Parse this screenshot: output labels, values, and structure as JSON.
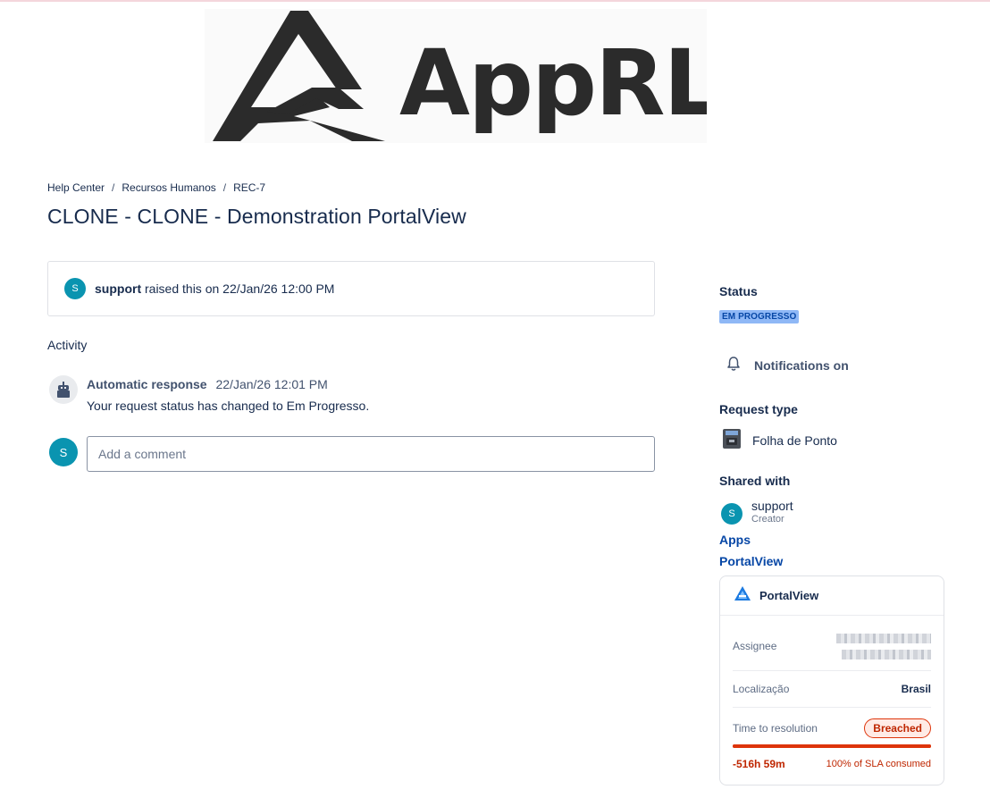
{
  "logo": {
    "text": "AppRL"
  },
  "breadcrumb": {
    "items": [
      "Help Center",
      "Recursos Humanos",
      "REC-7"
    ],
    "separator": "/"
  },
  "page_title": "CLONE - CLONE - Demonstration PortalView",
  "raised": {
    "avatar_initial": "S",
    "author": "support",
    "text": "raised this on 22/Jan/26 12:00 PM"
  },
  "activity": {
    "heading": "Activity",
    "items": [
      {
        "author": "Automatic response",
        "time": "22/Jan/26 12:01 PM",
        "message": "Your request status has changed to Em Progresso."
      }
    ]
  },
  "comment": {
    "avatar_initial": "S",
    "placeholder": "Add a comment"
  },
  "sidebar": {
    "status_label": "Status",
    "status_value": "EM PROGRESSO",
    "notifications": "Notifications on",
    "request_type_label": "Request type",
    "request_type_value": "Folha de Ponto",
    "shared_label": "Shared with",
    "shared_user": {
      "initial": "S",
      "name": "support",
      "role": "Creator"
    },
    "apps_label": "Apps",
    "apps_link": "PortalView"
  },
  "portalview_card": {
    "title": "PortalView",
    "assignee_label": "Assignee",
    "localizacao_label": "Localização",
    "localizacao_value": "Brasil",
    "resolution_label": "Time to resolution",
    "resolution_badge": "Breached",
    "sla_consumed_fraction": 1.0,
    "time_value": "-516h 59m",
    "sla_text": "100% of SLA consumed"
  },
  "colors": {
    "avatar": "#0a94b0",
    "status_lozenge": "#8fb8f6",
    "breached": "#de350b",
    "link": "#0747a6"
  },
  "icons": [
    "robot-icon",
    "bell-icon",
    "timeclock-icon",
    "portalview-logo-icon"
  ]
}
